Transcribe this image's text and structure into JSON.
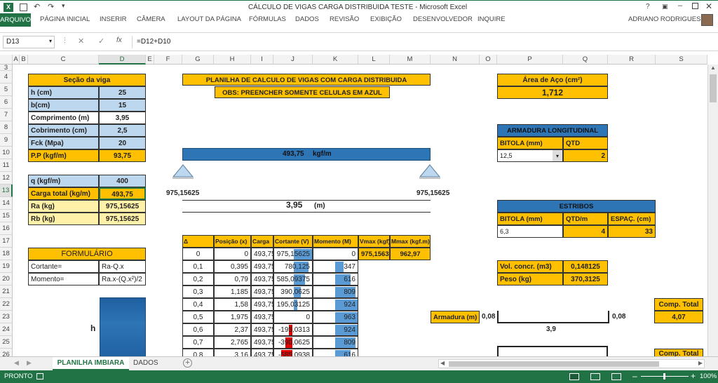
{
  "window": {
    "title": "CÁLCULO DE  VIGAS CARGA DISTRIBUIDA TESTE - Microsoft Excel",
    "help": "?",
    "user": "ADRIANO RODRIGUES"
  },
  "ribbon": {
    "tabs": [
      "ARQUIVO",
      "PÁGINA INICIAL",
      "INSERIR",
      "CÂMERA",
      "LAYOUT DA PÁGINA",
      "FÓRMULAS",
      "DADOS",
      "REVISÃO",
      "EXIBIÇÃO",
      "DESENVOLVEDOR",
      "INQUIRE"
    ]
  },
  "formula_bar": {
    "name_box": "D13",
    "fx": "fx",
    "formula": "=D12+D10"
  },
  "columns": [
    "A",
    "B",
    "C",
    "D",
    "E",
    "F",
    "G",
    "H",
    "I",
    "J",
    "K",
    "L",
    "M",
    "N",
    "O",
    "P",
    "Q",
    "R",
    "S"
  ],
  "rows": [
    "3",
    "4",
    "5",
    "6",
    "7",
    "8",
    "9",
    "10",
    "11",
    "12",
    "13",
    "14",
    "15",
    "16",
    "17",
    "18",
    "19",
    "20",
    "21",
    "22",
    "23",
    "24",
    "25",
    "26"
  ],
  "secao": {
    "title": "Seção da viga",
    "rows": [
      {
        "label": "h (cm)",
        "value": "25"
      },
      {
        "label": "b(cm)",
        "value": "15"
      },
      {
        "label": "Comprimento (m)",
        "value": "3,95"
      },
      {
        "label": "Cobrimento (cm)",
        "value": "2,5"
      },
      {
        "label": "Fck (Mpa)",
        "value": "20"
      }
    ],
    "pp_label": "P.P (kgf/m)",
    "pp_value": "93,75",
    "q_label": "q (kgf/m)",
    "q_value": "400",
    "carga_label": "Carga total (kg/m)",
    "carga_value": "493,75",
    "ra_label": "Ra (kg)",
    "ra_value": "975,15625",
    "rb_label": "Rb (kg)",
    "rb_value": "975,15625"
  },
  "planilha": {
    "title": "PLANILHA DE CALCULO DE VIGAS COM CARGA DISTRIBUIDA",
    "obs": "OBS: PREENCHER SOMENTE CELULAS EM AZUL",
    "load": "493,75",
    "load_unit": "kgf/m",
    "ra": "975,15625",
    "rb": "975,15625",
    "length": "3,95",
    "length_unit": "(m)"
  },
  "aco": {
    "title": "Área de Aço (cm²)",
    "value": "1,712"
  },
  "arm_long": {
    "title": "ARMADURA LONGITUDINAL",
    "h_bitola": "BITOLA (mm)",
    "h_qtd": "QTD",
    "bitola": "12,5",
    "qtd": "2"
  },
  "estribos": {
    "title": "ESTRIBOS",
    "h_bitola": "BITOLA (mm)",
    "h_qtd": "QTD/m",
    "h_esp": "ESPAÇ. (cm)",
    "bitola": "6,3",
    "qtd": "4",
    "esp": "33"
  },
  "vol": {
    "label": "Vol. concr. (m3)",
    "value": "0,148125",
    "peso_label": "Peso (kg)",
    "peso_value": "370,3125"
  },
  "formulario": {
    "title": "FORMULÁRIO",
    "rows": [
      {
        "label": "Cortante=",
        "expr": "Ra-Q.x"
      },
      {
        "label": "Momento=",
        "expr": "Ra.x-(Q.x²)/2"
      }
    ]
  },
  "table": {
    "headers": [
      "Δ",
      "Posição (x)",
      "Carga",
      "Cortante (V)",
      "Momento (M)",
      "Vmax (kgf)",
      "Mmax (kgf.m)"
    ],
    "rows": [
      [
        "0",
        "0",
        "493,75",
        "975,15625",
        "0"
      ],
      [
        "0,1",
        "0,395",
        "493,75",
        "780,125",
        "347"
      ],
      [
        "0,2",
        "0,79",
        "493,75",
        "585,09375",
        "616"
      ],
      [
        "0,3",
        "1,185",
        "493,75",
        "390,0625",
        "809"
      ],
      [
        "0,4",
        "1,58",
        "493,75",
        "195,03125",
        "924"
      ],
      [
        "0,5",
        "1,975",
        "493,75",
        "0",
        "963"
      ],
      [
        "0,6",
        "2,37",
        "493,75",
        "-195,0313",
        "924"
      ],
      [
        "0,7",
        "2,765",
        "493,75",
        "-390,0625",
        "809"
      ],
      [
        "0,8",
        "3,16",
        "493,75",
        "-585,0938",
        "616"
      ]
    ],
    "vmax": "975,1563",
    "mmax": "962,97"
  },
  "armadura": {
    "label": "Armadura (m)",
    "left": "0,08",
    "right": "0,08",
    "length": "3,9"
  },
  "comp_total": {
    "label": "Comp. Total",
    "value": "4,07",
    "label2": "Comp. Total"
  },
  "h_label": "h",
  "sheets": [
    "PLANILHA IMBIARA",
    "DADOS"
  ],
  "status": {
    "left": "PRONTO",
    "zoom": "100%"
  },
  "colors": {
    "accent": "#217346",
    "yellow": "#fec000",
    "lightblue": "#bdd7ee",
    "blue": "#2e75b6",
    "red": "#e00000"
  }
}
